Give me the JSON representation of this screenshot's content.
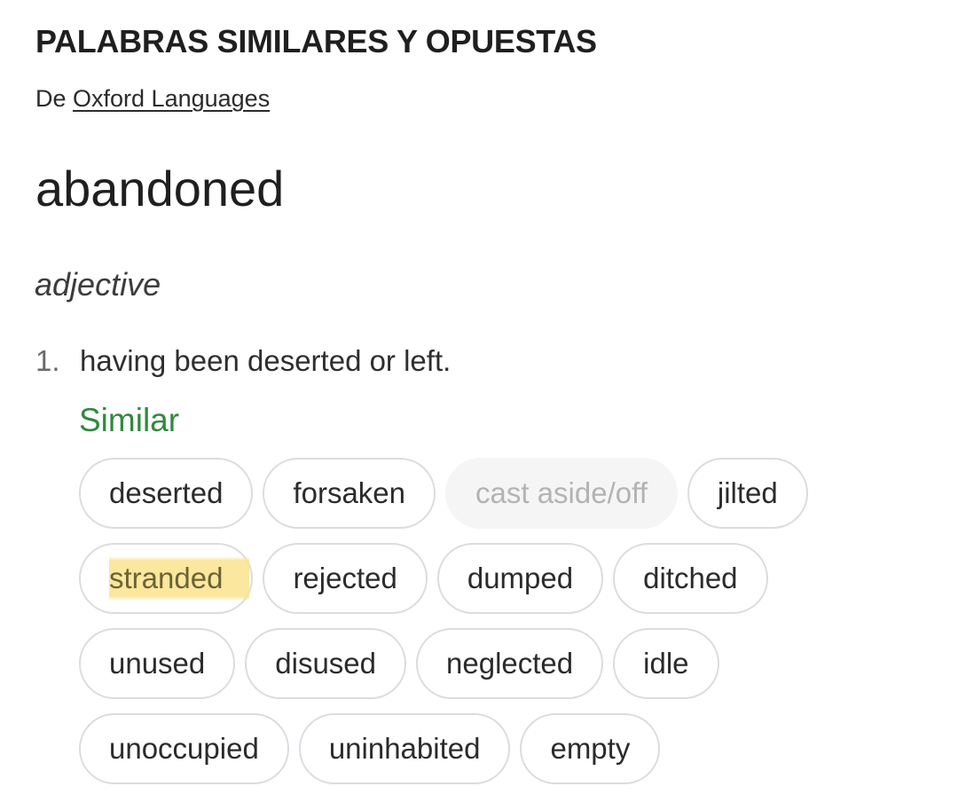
{
  "header": {
    "title": "PALABRAS SIMILARES Y OPUESTAS",
    "source_prefix": "De",
    "source_link": "Oxford Languages"
  },
  "entry": {
    "word": "abandoned",
    "part_of_speech": "adjective",
    "senses": [
      {
        "number": "1.",
        "definition": "having been deserted or left.",
        "similar_label": "Similar",
        "similar_rows": [
          [
            {
              "label": "deserted",
              "state": "normal"
            },
            {
              "label": "forsaken",
              "state": "normal"
            },
            {
              "label": "cast aside/off",
              "state": "disabled"
            },
            {
              "label": "jilted",
              "state": "normal"
            }
          ],
          [
            {
              "label": "stranded",
              "state": "highlighted"
            },
            {
              "label": "rejected",
              "state": "normal"
            },
            {
              "label": "dumped",
              "state": "normal"
            },
            {
              "label": "ditched",
              "state": "normal"
            }
          ],
          [
            {
              "label": "unused",
              "state": "normal"
            },
            {
              "label": "disused",
              "state": "normal"
            },
            {
              "label": "neglected",
              "state": "normal"
            },
            {
              "label": "idle",
              "state": "normal"
            }
          ],
          [
            {
              "label": "unoccupied",
              "state": "normal"
            },
            {
              "label": "uninhabited",
              "state": "normal"
            },
            {
              "label": "empty",
              "state": "normal"
            }
          ]
        ]
      }
    ]
  },
  "colors": {
    "similar_label": "#2f8a3c",
    "highlight": "#fae38c",
    "chip_border": "#dadce0",
    "chip_disabled_bg": "#f5f5f5"
  }
}
